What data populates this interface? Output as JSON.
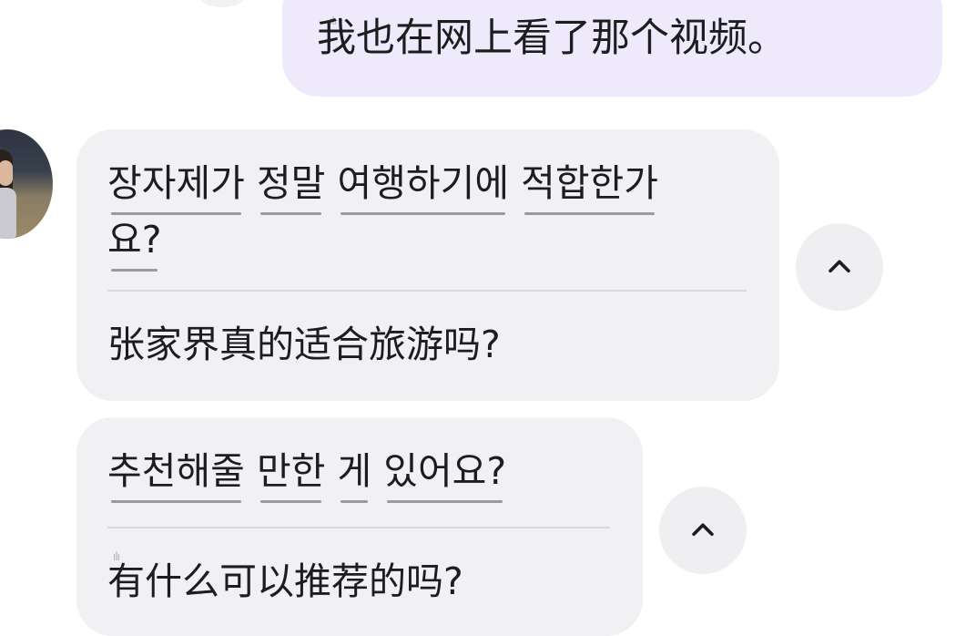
{
  "outgoing": {
    "text": "我也在网上看了那个视频。"
  },
  "messages": [
    {
      "original_words": [
        "장자제가",
        "정말",
        "여행하기에",
        "적합한가"
      ],
      "original_tail": "요?",
      "translation": "张家界真的适合旅游吗?"
    },
    {
      "original_words": [
        "추천해줄",
        "만한",
        "게",
        "있어요?"
      ],
      "translation": "有什么可以推荐的吗?"
    }
  ],
  "icons": {
    "collapse": "chevron-up-icon",
    "avatar": "contact-avatar"
  },
  "colors": {
    "outgoing_bubble": "#eeeafc",
    "incoming_bubble": "#f1f1f3",
    "background": "#ffffff",
    "word_underline": "#9a9aa1"
  }
}
